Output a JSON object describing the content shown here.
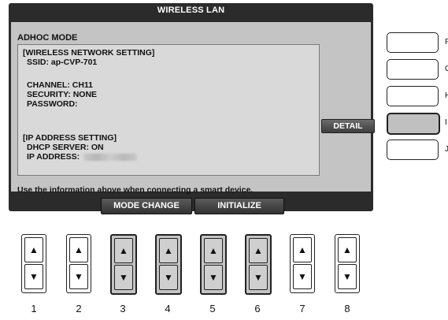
{
  "window": {
    "title": "WIRELESS LAN"
  },
  "panel": {
    "mode_label": "ADHOC MODE",
    "wireless_heading": "[WIRELESS NETWORK SETTING]",
    "ssid": "SSID: ap-CVP-701",
    "channel": "CHANNEL: CH11",
    "security": "SECURITY: NONE",
    "password": "PASSWORD:",
    "ip_heading": "[IP ADDRESS SETTING]",
    "dhcp": "DHCP SERVER: ON",
    "ip_label": "IP ADDRESS:",
    "hint": "Use the information above when connecting a smart device."
  },
  "buttons": {
    "detail": "DETAIL",
    "mode_change": "MODE CHANGE",
    "initialize": "INITIALIZE"
  },
  "side_letters": [
    "F",
    "G",
    "H",
    "I",
    "J"
  ],
  "active_side_button": "I",
  "number_keys": [
    "1",
    "2",
    "3",
    "4",
    "5",
    "6",
    "7",
    "8"
  ],
  "highlighted_keys": [
    "3",
    "4",
    "5",
    "6"
  ],
  "icons": {
    "up": "up-arrow-icon",
    "down": "down-arrow-icon"
  }
}
